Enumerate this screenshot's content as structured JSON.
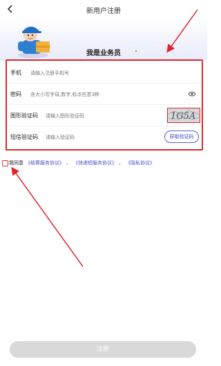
{
  "header": {
    "title": "新用户注册",
    "back_icon": "chevron-left-icon"
  },
  "hero": {
    "role_label": "我是业务员",
    "mascot": "delivery-courier-illustration"
  },
  "form": {
    "phone": {
      "label": "手机",
      "placeholder": "请输入注册手机号"
    },
    "password": {
      "label": "密码",
      "placeholder": "含大小写字母,数字,标点任意3种",
      "icon": "eye-icon"
    },
    "image_code": {
      "label": "图形验证码",
      "placeholder": "请输入图形验证码",
      "captcha_text": "1G5A"
    },
    "sms_code": {
      "label": "短信验证码",
      "placeholder": "请输入验证码",
      "button": "获取验证码"
    }
  },
  "agreement": {
    "prefix": "我同意",
    "links": [
      "《结算服务协议》",
      "《快递短服务协议》",
      "《隐私协议》"
    ],
    "separator": "、"
  },
  "register_button": "注册",
  "colors": {
    "accent": "#4350c8",
    "highlight": "#e0242b",
    "disabled": "#d9d9d9"
  }
}
